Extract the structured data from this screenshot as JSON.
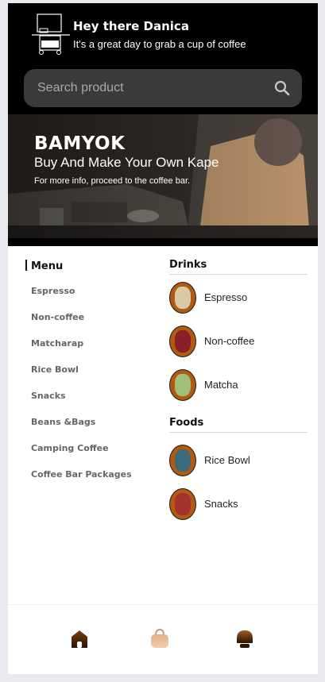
{
  "header": {
    "greeting_title": "Hey there Danica",
    "greeting_subtitle": "It's a great day to grab a cup of coffee"
  },
  "search": {
    "placeholder": "Search product",
    "icon": "search-icon"
  },
  "banner": {
    "title": "BAMYOK",
    "subtitle": "Buy And Make Your Own Kape",
    "note": "For more info, proceed to the coffee bar."
  },
  "menu": {
    "heading": "Menu",
    "items": [
      {
        "label": "Espresso"
      },
      {
        "label": "Non-coffee"
      },
      {
        "label": "Matcharap"
      },
      {
        "label": "Rice Bowl"
      },
      {
        "label": "Snacks"
      },
      {
        "label": "Beans &Bags"
      },
      {
        "label": "Camping Coffee"
      },
      {
        "label": "Coffee Bar Packages"
      }
    ]
  },
  "drinks": {
    "heading": "Drinks",
    "items": [
      {
        "label": "Espresso",
        "color": "#d9c9a8"
      },
      {
        "label": "Non-coffee",
        "color": "#8a1f2a"
      },
      {
        "label": "Matcha",
        "color": "#9fbf7a"
      }
    ]
  },
  "foods": {
    "heading": "Foods",
    "items": [
      {
        "label": "Rice Bowl",
        "color": "#3b6a78"
      },
      {
        "label": "Snacks",
        "color": "#a3322c"
      }
    ]
  },
  "bottom_nav": {
    "items": [
      {
        "icon": "home-icon",
        "active": true
      },
      {
        "icon": "bag-icon",
        "active": false
      },
      {
        "icon": "profile-icon",
        "active": false
      }
    ]
  },
  "colors": {
    "accent": "#b25a0f",
    "header_bg": "#000000",
    "search_bg": "#3a3a3a"
  }
}
